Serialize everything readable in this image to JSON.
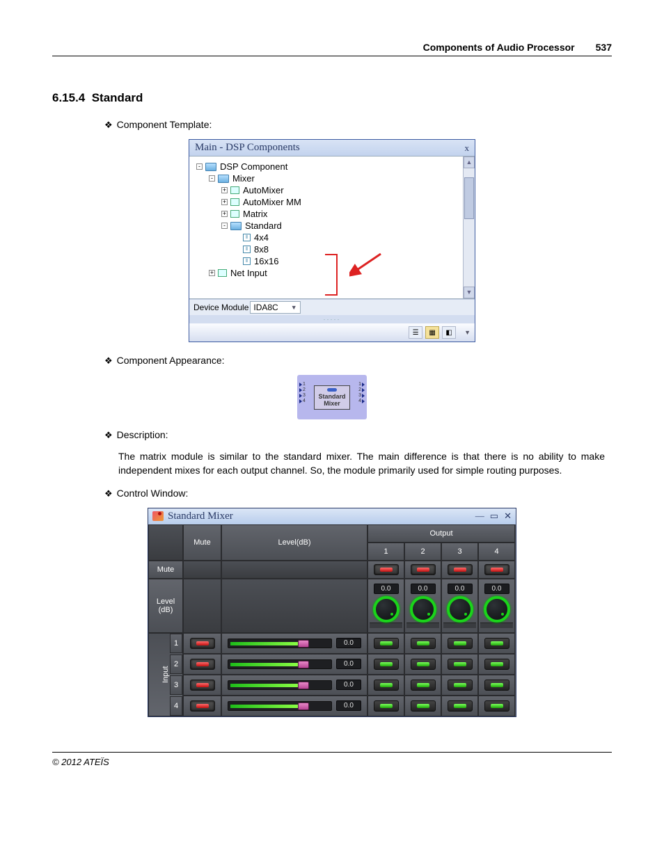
{
  "header": {
    "title": "Components of Audio Processor",
    "page": "537"
  },
  "section": {
    "number": "6.15.4",
    "title": "Standard"
  },
  "headings": {
    "template": "Component Template:",
    "appearance": "Component Appearance:",
    "description": "Description:",
    "control": "Control Window:"
  },
  "tree_window": {
    "title": "Main - DSP Components",
    "items": {
      "root": "DSP Component",
      "mixer": "Mixer",
      "automixer": "AutoMixer",
      "automixer_mm": "AutoMixer MM",
      "matrix": "Matrix",
      "standard": "Standard",
      "s4x4": "4x4",
      "s8x8": "8x8",
      "s16x16": "16x16",
      "netinput": "Net Input"
    },
    "device_label": "Device Module",
    "device_value": "IDA8C"
  },
  "component": {
    "line1": "Standard",
    "line2": "Mixer",
    "ports": [
      "1",
      "2",
      "3",
      "4"
    ]
  },
  "description_text": "The matrix module is similar to the standard mixer. The main difference is that there is no ability to make independent mixes for each output channel. So, the module primarily used for simple routing purposes.",
  "mixer": {
    "title": "Standard Mixer",
    "mute_hdr": "Mute",
    "level_hdr": "Level(dB)",
    "output_hdr": "Output",
    "mute_row": "Mute",
    "level_row_l1": "Level",
    "level_row_l2": "(dB)",
    "input_label": "Input",
    "outputs": [
      "1",
      "2",
      "3",
      "4"
    ],
    "out_levels": [
      "0.0",
      "0.0",
      "0.0",
      "0.0"
    ],
    "inputs": [
      "1",
      "2",
      "3",
      "4"
    ],
    "in_levels": [
      "0.0",
      "0.0",
      "0.0",
      "0.0"
    ]
  },
  "footer": "© 2012 ATEÏS"
}
